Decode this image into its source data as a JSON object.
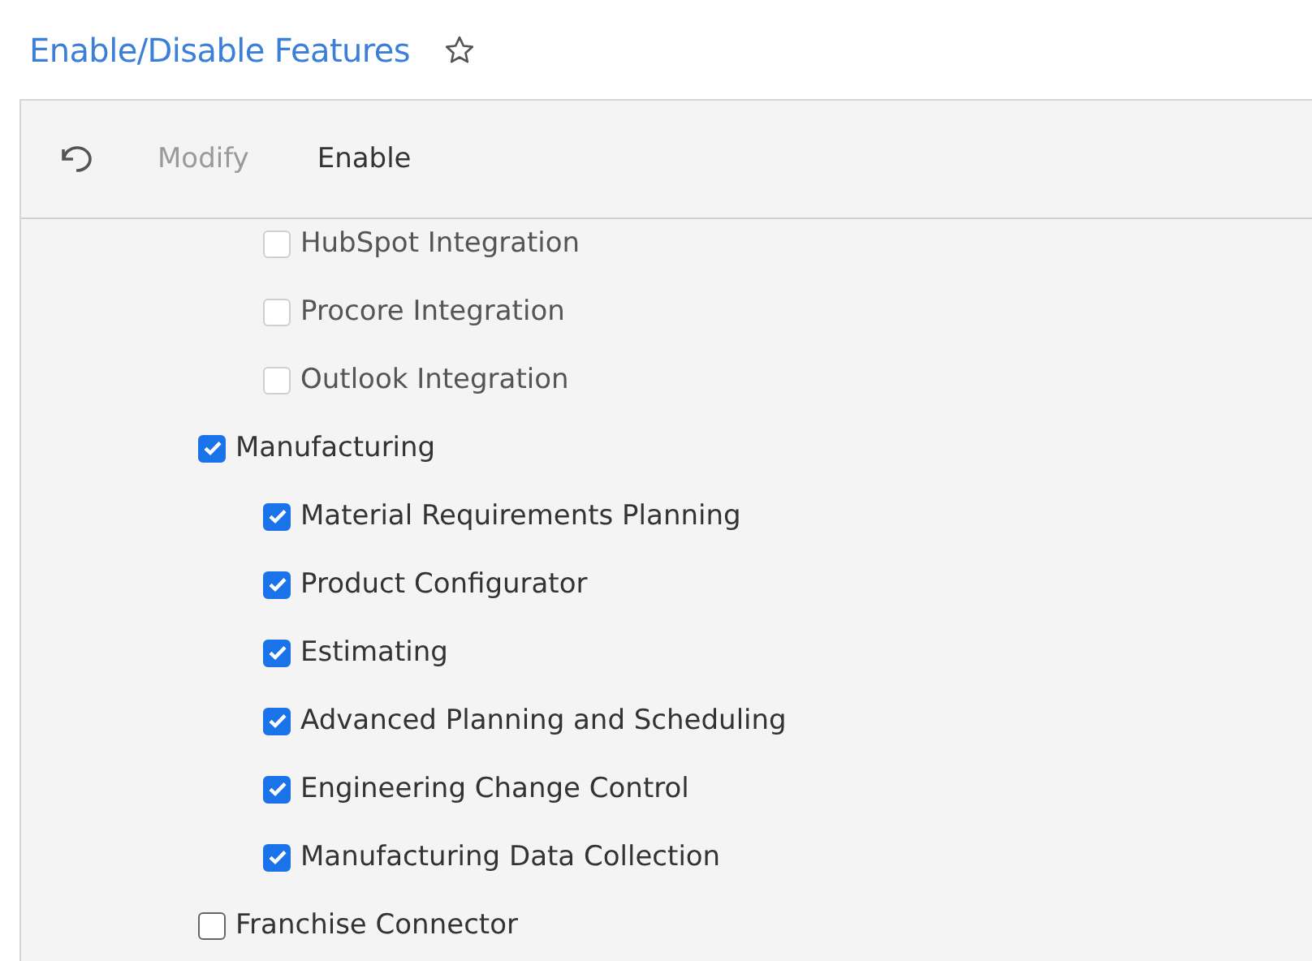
{
  "page": {
    "title": "Enable/Disable Features",
    "favorite": false
  },
  "toolbar": {
    "buttons": [
      {
        "kind": "undo",
        "disabled": false
      },
      {
        "kind": "text",
        "label": "Modify",
        "disabled": true
      },
      {
        "kind": "text",
        "label": "Enable",
        "disabled": false
      }
    ]
  },
  "features": [
    {
      "children": [
        {
          "label": "HubSpot Integration",
          "checked": false,
          "disabled": true
        },
        {
          "label": "Procore Integration",
          "checked": false,
          "disabled": true
        },
        {
          "label": "Outlook Integration",
          "checked": false,
          "disabled": true
        }
      ]
    },
    {
      "label": "Manufacturing",
      "checked": true,
      "disabled": false,
      "children": [
        {
          "label": "Material Requirements Planning",
          "checked": true,
          "disabled": false
        },
        {
          "label": "Product Configurator",
          "checked": true,
          "disabled": false
        },
        {
          "label": "Estimating",
          "checked": true,
          "disabled": false
        },
        {
          "label": "Advanced Planning and Scheduling",
          "checked": true,
          "disabled": false
        },
        {
          "label": "Engineering Change Control",
          "checked": true,
          "disabled": false
        },
        {
          "label": "Manufacturing Data Collection",
          "checked": true,
          "disabled": false
        }
      ]
    },
    {
      "label": "Franchise Connector",
      "checked": false,
      "disabled": false
    }
  ]
}
